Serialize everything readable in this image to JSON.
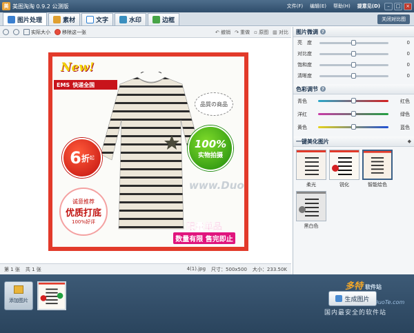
{
  "window": {
    "title": "美图淘淘 0.9.2 公测版",
    "menus": [
      "文件(F)",
      "编辑(E)",
      "帮助(H)"
    ],
    "feedback": "提意见(D)",
    "minimize": "–",
    "maximize": "□",
    "close": "×"
  },
  "tabs": [
    {
      "label": "图片处理",
      "icon": "picture-icon",
      "color": "#3a7fcf",
      "active": true
    },
    {
      "label": "素材",
      "icon": "material-icon",
      "color": "#e0a030"
    },
    {
      "label": "文字",
      "icon": "text-icon",
      "color": "#2a7fd4"
    },
    {
      "label": "水印",
      "icon": "watermark-icon",
      "color": "#3a8fbf"
    },
    {
      "label": "边框",
      "icon": "frame-icon",
      "color": "#47a447"
    }
  ],
  "close_compare": "关闭对比图",
  "toolbar": {
    "actual_size": "实际大小",
    "remove_one": "移除这一张",
    "undo": "撤销",
    "redo": "重做",
    "original": "原图",
    "compare": "对比"
  },
  "photo": {
    "new_badge": "New!",
    "ems_text": "EMS",
    "ems_sub": "快递全国",
    "bubble": "品質の商品",
    "green_big": "100%",
    "green_small": "实物拍摄",
    "discount_num": "6",
    "discount_unit": "折",
    "discount_start": "起",
    "promo_l1": "诚意推荐",
    "promo_l2": "优质打底",
    "promo_l3": "100%好评",
    "limited_a": "限量单品",
    "limited_b": "数量有限 售完即止",
    "watermark": "www.DuoTe.com"
  },
  "status": {
    "page": "第 1 张",
    "total": "共 1 张",
    "filename": "4(1).jpg",
    "dims": "尺寸：500x500",
    "size": "大小：233.50K"
  },
  "panel": {
    "adjust_title": "图片微调",
    "adjust": [
      {
        "label": "亮　度",
        "value": "0"
      },
      {
        "label": "对比度",
        "value": "0"
      },
      {
        "label": "饱和度",
        "value": "0"
      },
      {
        "label": "清晰度",
        "value": "0"
      }
    ],
    "color_title": "色彩调节",
    "colors": [
      {
        "left": "青色",
        "right": "红色",
        "from": "#2aa7c9",
        "to": "#d42020"
      },
      {
        "left": "洋红",
        "right": "绿色",
        "from": "#c93aa7",
        "to": "#20a040"
      },
      {
        "left": "黄色",
        "right": "蓝色",
        "from": "#e6d21a",
        "to": "#2050d4"
      }
    ],
    "beautify_title": "一键美化图片",
    "presets": [
      {
        "label": "柔光"
      },
      {
        "label": "锐化"
      },
      {
        "label": "智能绘色"
      },
      {
        "label": "黑白色"
      }
    ]
  },
  "bottom": {
    "add_image": "添加图片",
    "generate": "生成图片",
    "wm_brand": "多特",
    "wm_site": "软件站",
    "wm_url": "www.DuoTe.com",
    "wm_sub": "国内最安全的软件站"
  }
}
